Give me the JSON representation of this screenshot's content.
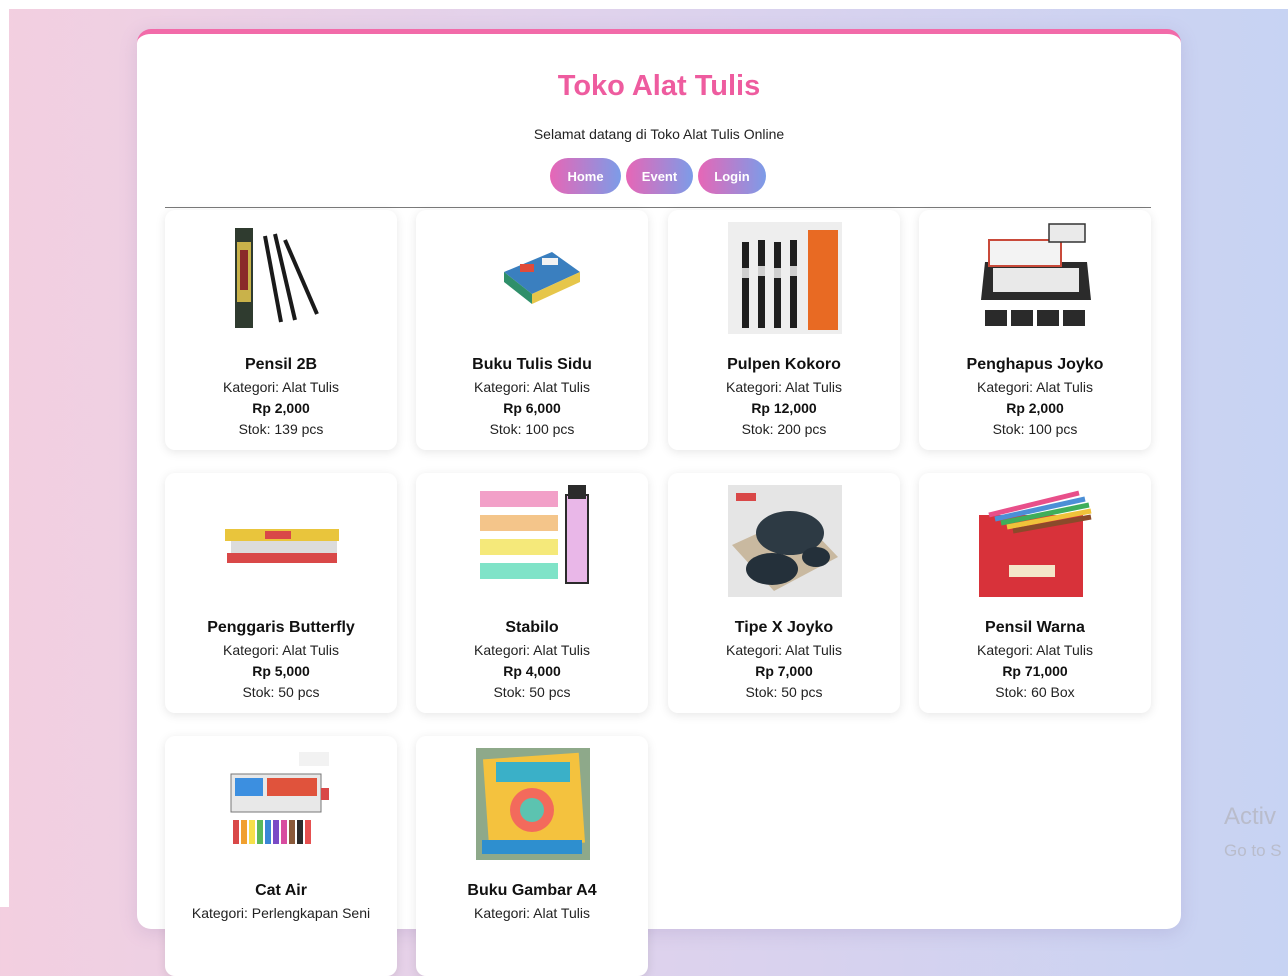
{
  "header": {
    "title": "Toko Alat Tulis",
    "subtitle": "Selamat datang di Toko Alat Tulis Online"
  },
  "nav": {
    "home": "Home",
    "event": "Event",
    "login": "Login"
  },
  "products": [
    {
      "name": "Pensil 2B",
      "category": "Kategori: Alat Tulis",
      "price": "Rp 2,000",
      "stock": "Stok: 139 pcs"
    },
    {
      "name": "Buku Tulis Sidu",
      "category": "Kategori: Alat Tulis",
      "price": "Rp 6,000",
      "stock": "Stok: 100 pcs"
    },
    {
      "name": "Pulpen Kokoro",
      "category": "Kategori: Alat Tulis",
      "price": "Rp 12,000",
      "stock": "Stok: 200 pcs"
    },
    {
      "name": "Penghapus Joyko",
      "category": "Kategori: Alat Tulis",
      "price": "Rp 2,000",
      "stock": "Stok: 100 pcs"
    },
    {
      "name": "Penggaris Butterfly",
      "category": "Kategori: Alat Tulis",
      "price": "Rp 5,000",
      "stock": "Stok: 50 pcs"
    },
    {
      "name": "Stabilo",
      "category": "Kategori: Alat Tulis",
      "price": "Rp 4,000",
      "stock": "Stok: 50 pcs"
    },
    {
      "name": "Tipe X Joyko",
      "category": "Kategori: Alat Tulis",
      "price": "Rp 7,000",
      "stock": "Stok: 50 pcs"
    },
    {
      "name": "Pensil Warna",
      "category": "Kategori: Alat Tulis",
      "price": "Rp 71,000",
      "stock": "Stok: 60 Box"
    },
    {
      "name": "Cat Air",
      "category": "Kategori: Perlengkapan Seni",
      "price": "",
      "stock": ""
    },
    {
      "name": "Buku Gambar A4",
      "category": "Kategori: Alat Tulis",
      "price": "",
      "stock": ""
    }
  ],
  "watermark": {
    "line1": "Activ",
    "line2": "Go to S"
  },
  "colors": {
    "accent": "#ee5c9f",
    "nav_gradient_start": "#e766b6",
    "nav_gradient_end": "#7c9ce8"
  }
}
